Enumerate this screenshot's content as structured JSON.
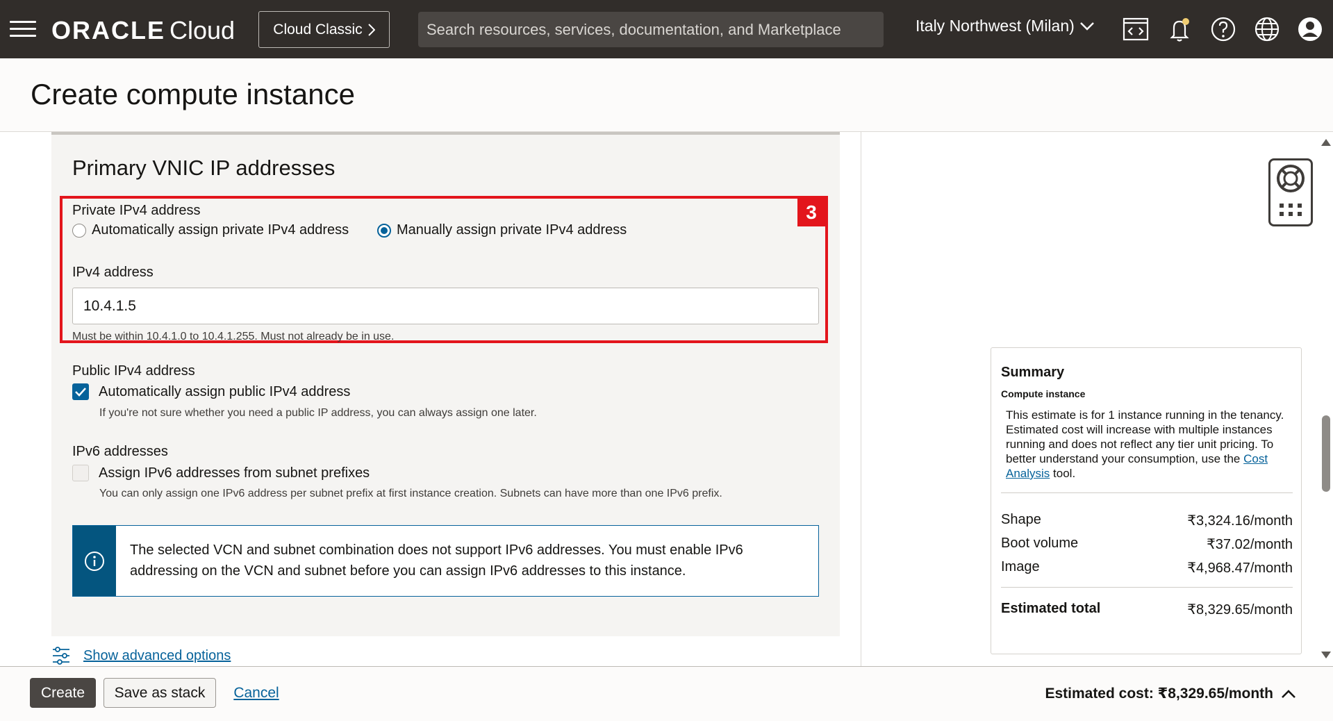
{
  "header": {
    "brand": "ORACLE",
    "brand_suffix": "Cloud",
    "classic_button": "Cloud Classic",
    "search_placeholder": "Search resources, services, documentation, and Marketplace",
    "region": "Italy Northwest (Milan)"
  },
  "page": {
    "title": "Create compute instance"
  },
  "vnic": {
    "section_title": "Primary VNIC IP addresses",
    "annotation_number": "3",
    "private_ipv4_label": "Private IPv4 address",
    "option_auto": "Automatically assign private IPv4 address",
    "option_manual": "Manually assign private IPv4 address",
    "selected_option": "manual",
    "ipv4_address_label": "IPv4 address",
    "ipv4_address_value": "10.4.1.5",
    "ipv4_hint": "Must be within 10.4.1.0 to 10.4.1.255. Must not already be in use.",
    "public_ipv4_label": "Public IPv4 address",
    "public_auto_label": "Automatically assign public IPv4 address",
    "public_auto_checked": true,
    "public_auto_hint": "If you're not sure whether you need a public IP address, you can always assign one later.",
    "ipv6_label": "IPv6 addresses",
    "ipv6_assign_label": "Assign IPv6 addresses from subnet prefixes",
    "ipv6_assign_checked": false,
    "ipv6_hint": "You can only assign one IPv6 address per subnet prefix at first instance creation. Subnets can have more than one IPv6 prefix.",
    "info_message": "The selected VCN and subnet combination does not support IPv6 addresses. You must enable IPv6 addressing on the VCN and subnet before you can assign IPv6 addresses to this instance.",
    "advanced_link": "Show advanced options"
  },
  "summary": {
    "title": "Summary",
    "subtitle": "Compute instance",
    "description_pre": "This estimate is for 1 instance running in the tenancy. Estimated cost will increase with multiple instances running and does not reflect any tier unit pricing. To better understand your consumption, use the",
    "description_link": "Cost Analysis",
    "description_post": "tool.",
    "rows": [
      {
        "label": "Shape",
        "value": "₹3,324.16/month"
      },
      {
        "label": "Boot volume",
        "value": "₹37.02/month"
      },
      {
        "label": "Image",
        "value": "₹4,968.47/month"
      }
    ],
    "total_label": "Estimated total",
    "total_value": "₹8,329.65/month"
  },
  "footer": {
    "create": "Create",
    "save_stack": "Save as stack",
    "cancel": "Cancel",
    "estimated_cost": "Estimated cost: ₹8,329.65/month"
  },
  "colors": {
    "header_bg": "#312d2a",
    "accent": "#06629a",
    "annotation_red": "#e3151c"
  }
}
